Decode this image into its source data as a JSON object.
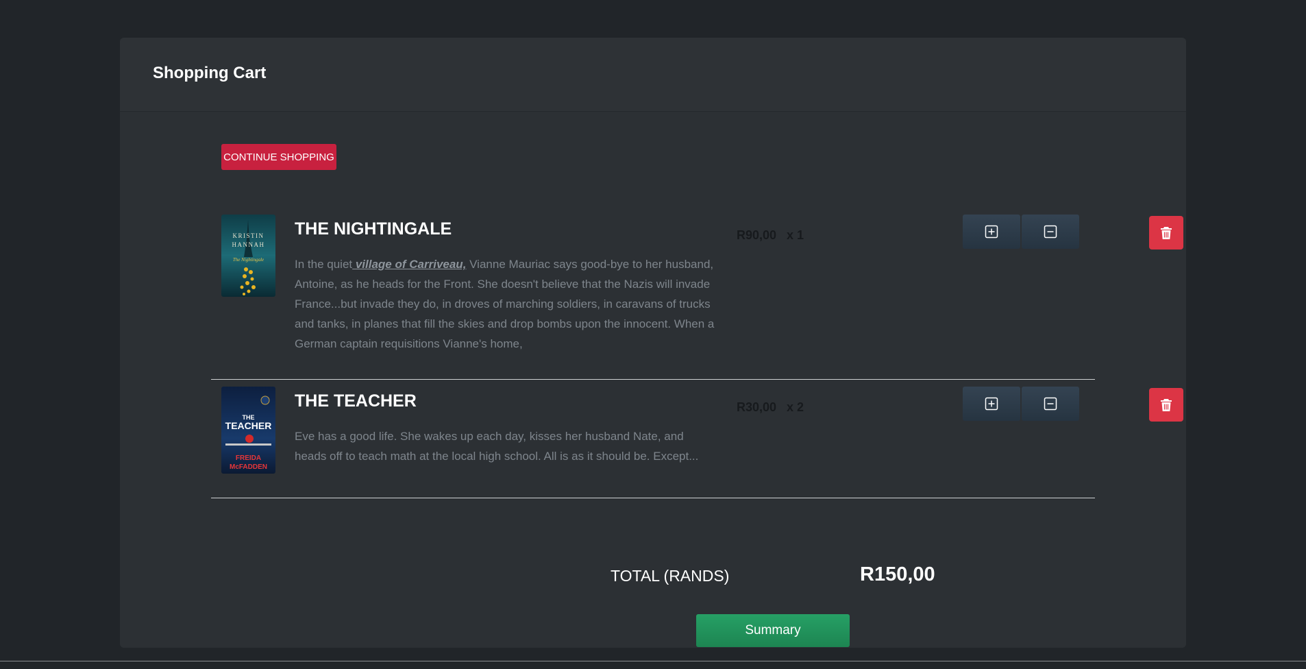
{
  "page": {
    "title": "Shopping Cart"
  },
  "actions": {
    "continue_label": "CONTINUE SHOPPING",
    "summary_label": "Summary"
  },
  "cart": {
    "items": [
      {
        "title": "THE NIGHTINGALE",
        "desc_prefix": "In the quiet",
        "desc_link": " village of Carriveau,",
        "desc_rest": " Vianne Mauriac says good-bye to her husband, Antoine, as he heads for the Front. She doesn't believe that the Nazis will invade France...but invade they do, in droves of marching soldiers, in caravans of trucks and tanks, in planes that fill the skies and drop bombs upon the innocent. When a German captain requisitions Vianne's home,",
        "price": "R90,00",
        "qty": "x 1",
        "cover": {
          "line1": "KRISTIN",
          "line2": "HANNAH",
          "line3": "The Nightingale"
        }
      },
      {
        "title": "THE TEACHER",
        "description": "Eve has a good life. She wakes up each day, kisses her husband Nate, and heads off to teach math at the local high school. All is as it should be. Except...",
        "price": "R30,00",
        "qty": "x 2",
        "cover": {
          "line1": "THE",
          "line2": "TEACHER",
          "line3": "FREIDA",
          "line4": "McFADDEN"
        }
      }
    ]
  },
  "total": {
    "label": "TOTAL (RANDS)",
    "value": "R150,00"
  },
  "colors": {
    "background": "#212529",
    "card": "#2c3034",
    "danger": "#dc3545",
    "success": "#1f8f5b",
    "continue": "#c8213f"
  },
  "icons": {
    "increase": "plus-square-icon",
    "decrease": "minus-square-icon",
    "remove": "trash-icon"
  }
}
